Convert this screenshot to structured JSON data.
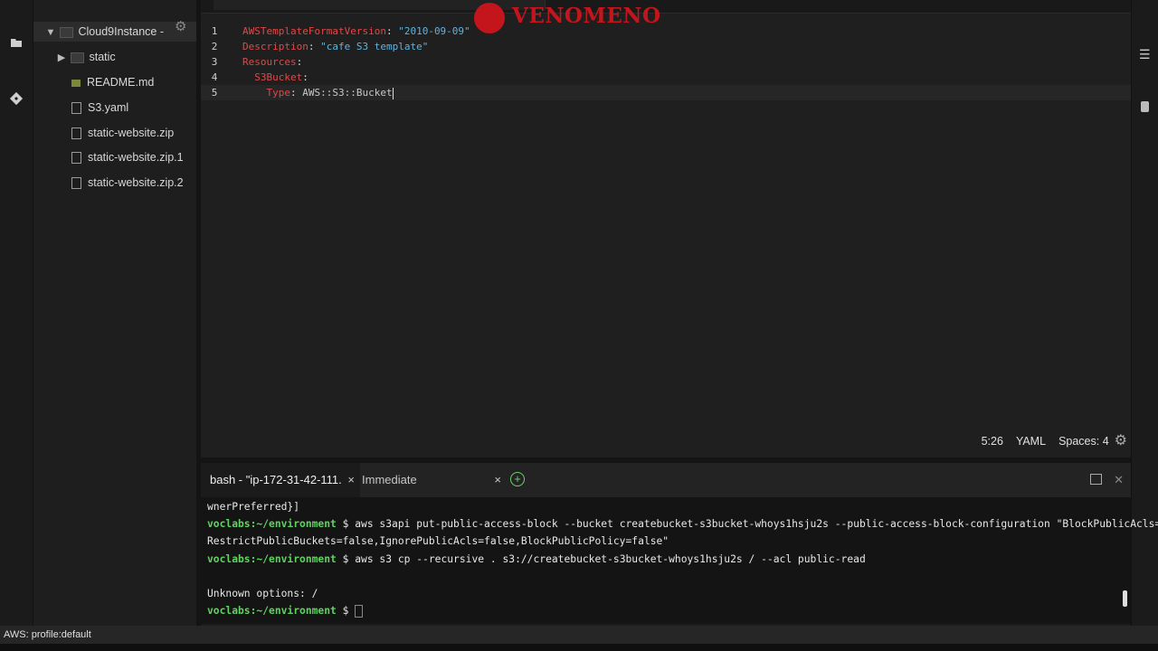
{
  "sidebar": {
    "root_label": "Cloud9Instance -",
    "items": [
      {
        "label": "static",
        "kind": "folder"
      },
      {
        "label": "README.md",
        "kind": "md"
      },
      {
        "label": "S3.yaml",
        "kind": "file"
      },
      {
        "label": "static-website.zip",
        "kind": "file"
      },
      {
        "label": "static-website.zip.1",
        "kind": "file"
      },
      {
        "label": "static-website.zip.2",
        "kind": "file"
      }
    ]
  },
  "editor": {
    "line_numbers": [
      "1",
      "2",
      "3",
      "4",
      "5"
    ],
    "lines": [
      {
        "key": "AWSTemplateFormatVersion",
        "sep": ": ",
        "value": "\"2010-09-09\"",
        "indent": ""
      },
      {
        "key": "Description",
        "sep": ": ",
        "value": "\"cafe S3 template\"",
        "indent": ""
      },
      {
        "key": "Resources",
        "sep": ":",
        "value": "",
        "indent": ""
      },
      {
        "key": "S3Bucket",
        "sep": ":",
        "value": "",
        "indent": "  "
      },
      {
        "key": "Type",
        "sep": ": ",
        "value": "AWS::S3::Bucket",
        "indent": "    "
      }
    ],
    "status": {
      "position": "5:26",
      "language": "YAML",
      "spaces": "Spaces: 4"
    }
  },
  "watermark": "VENOMENO",
  "terminal": {
    "tabs": [
      {
        "label": "bash - \"ip-172-31-42-111.",
        "close": "×"
      },
      {
        "label": "Immediate",
        "close": "×"
      }
    ],
    "lines": {
      "l0": "wnerPreferred}]",
      "p1": "voclabs:~/environment",
      "c1": " $ aws s3api put-public-access-block --bucket createbucket-s3bucket-whoys1hsju2s --public-access-block-configuration \"BlockPublicAcls=false,",
      "l2": "RestrictPublicBuckets=false,IgnorePublicAcls=false,BlockPublicPolicy=false\"",
      "p3": "voclabs:~/environment",
      "c3": " $ aws s3 cp --recursive . s3://createbucket-s3bucket-whoys1hsju2s / --acl public-read",
      "l5": "Unknown options: /",
      "p6": "voclabs:~/environment",
      "c6": " $ "
    }
  },
  "bottom_bar": {
    "profile": "AWS: profile:default"
  },
  "colors": {
    "accent_red": "#c4151c",
    "prompt_green": "#5fd35f",
    "string_blue": "#5fb3e0",
    "key_red": "#e04848"
  }
}
